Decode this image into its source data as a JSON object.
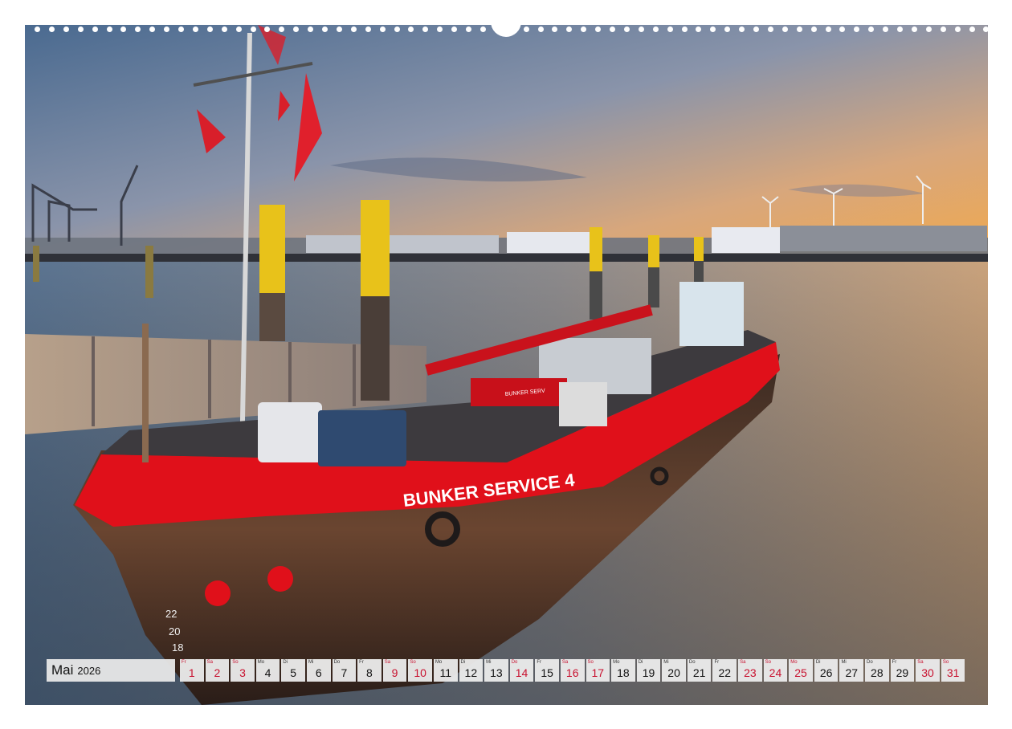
{
  "photo": {
    "subject": "harbor-bunker-boat",
    "hull_text": "BUNKER SERVICE 4",
    "hull_small_text": "BUNKER SERV",
    "draft_marks": [
      "22",
      "20",
      "18"
    ]
  },
  "calendar": {
    "month": "Mai",
    "year": "2026",
    "days": [
      {
        "wd": "Fr",
        "d": "1",
        "we": true
      },
      {
        "wd": "Sa",
        "d": "2",
        "we": true
      },
      {
        "wd": "So",
        "d": "3",
        "we": true
      },
      {
        "wd": "Mo",
        "d": "4",
        "we": false
      },
      {
        "wd": "Di",
        "d": "5",
        "we": false
      },
      {
        "wd": "Mi",
        "d": "6",
        "we": false
      },
      {
        "wd": "Do",
        "d": "7",
        "we": false
      },
      {
        "wd": "Fr",
        "d": "8",
        "we": false
      },
      {
        "wd": "Sa",
        "d": "9",
        "we": true
      },
      {
        "wd": "So",
        "d": "10",
        "we": true
      },
      {
        "wd": "Mo",
        "d": "11",
        "we": false
      },
      {
        "wd": "Di",
        "d": "12",
        "we": false
      },
      {
        "wd": "Mi",
        "d": "13",
        "we": false
      },
      {
        "wd": "Do",
        "d": "14",
        "we": true
      },
      {
        "wd": "Fr",
        "d": "15",
        "we": false
      },
      {
        "wd": "Sa",
        "d": "16",
        "we": true
      },
      {
        "wd": "So",
        "d": "17",
        "we": true
      },
      {
        "wd": "Mo",
        "d": "18",
        "we": false
      },
      {
        "wd": "Di",
        "d": "19",
        "we": false
      },
      {
        "wd": "Mi",
        "d": "20",
        "we": false
      },
      {
        "wd": "Do",
        "d": "21",
        "we": false
      },
      {
        "wd": "Fr",
        "d": "22",
        "we": false
      },
      {
        "wd": "Sa",
        "d": "23",
        "we": true
      },
      {
        "wd": "So",
        "d": "24",
        "we": true
      },
      {
        "wd": "Mo",
        "d": "25",
        "we": true
      },
      {
        "wd": "Di",
        "d": "26",
        "we": false
      },
      {
        "wd": "Mi",
        "d": "27",
        "we": false
      },
      {
        "wd": "Do",
        "d": "28",
        "we": false
      },
      {
        "wd": "Fr",
        "d": "29",
        "we": false
      },
      {
        "wd": "Sa",
        "d": "30",
        "we": true
      },
      {
        "wd": "So",
        "d": "31",
        "we": true
      }
    ]
  },
  "colors": {
    "weekend_red": "#c8102e",
    "hull_red": "#e0101a",
    "bollard_yellow": "#e8c21a"
  }
}
